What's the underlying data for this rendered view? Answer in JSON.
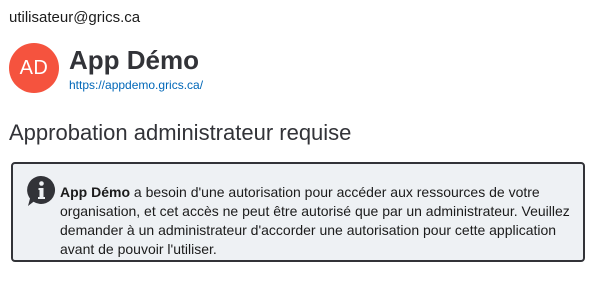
{
  "account": {
    "email": "utilisateur@grics.ca"
  },
  "app": {
    "avatar_initials": "AD",
    "avatar_color": "#f5533e",
    "name": "App Démo",
    "url": "https://appdemo.grics.ca/"
  },
  "page": {
    "heading": "Approbation administrateur requise"
  },
  "message": {
    "icon": "info-icon",
    "app_name": "App Démo",
    "body": " a besoin d'une autorisation pour accéder aux ressources de votre organisation, et cet accès ne peut être autorisé que par un administrateur. Veuillez demander à un administrateur d'accorder une autorisation pour cette application avant de pouvoir l'utiliser."
  },
  "colors": {
    "text": "#323338",
    "link": "#0067b8",
    "box_background": "#eef1f4"
  }
}
